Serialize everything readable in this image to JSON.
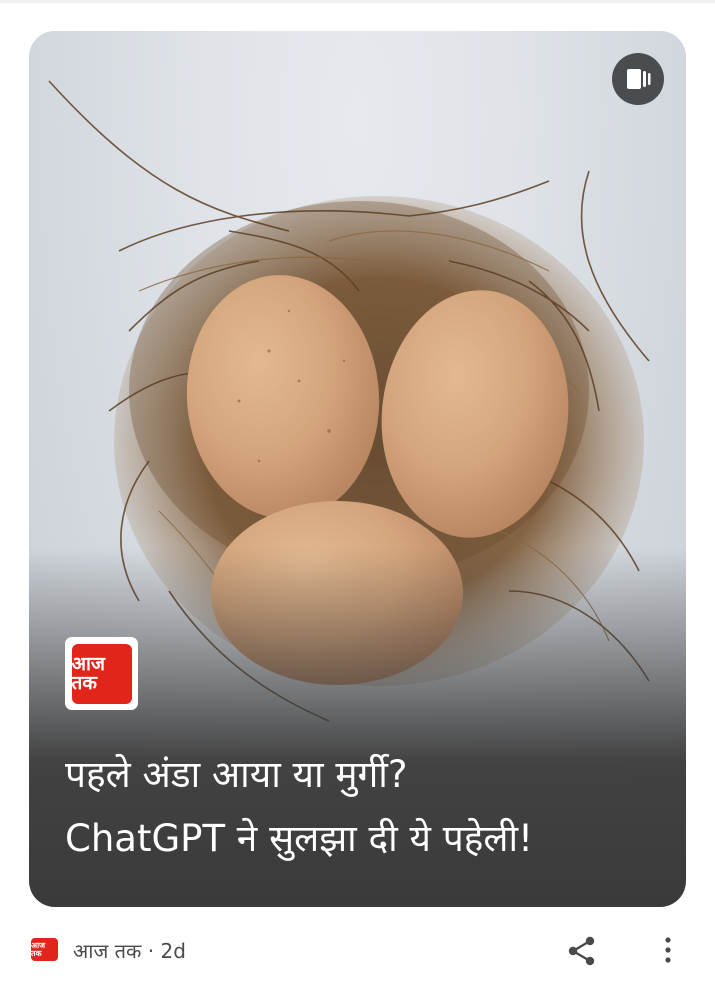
{
  "card": {
    "image_alt": "three-eggs-in-nest",
    "publisher_logo_text": "आज तक",
    "headline_line1": "पहले अंडा आया या मुर्गी?",
    "headline_line2": "ChatGPT ने सुलझा दी ये पहेली!",
    "stories_icon": "web-stories-icon"
  },
  "footer": {
    "publisher_logo_text": "आज तक",
    "source_line": "आज तक · 2d",
    "share_icon": "share-icon",
    "more_icon": "more-vert-icon"
  },
  "colors": {
    "brand_red": "#e1251b",
    "headline_text": "#ffffff",
    "card_shade": "#3a3a3a",
    "footer_text": "#4a4a4a"
  }
}
